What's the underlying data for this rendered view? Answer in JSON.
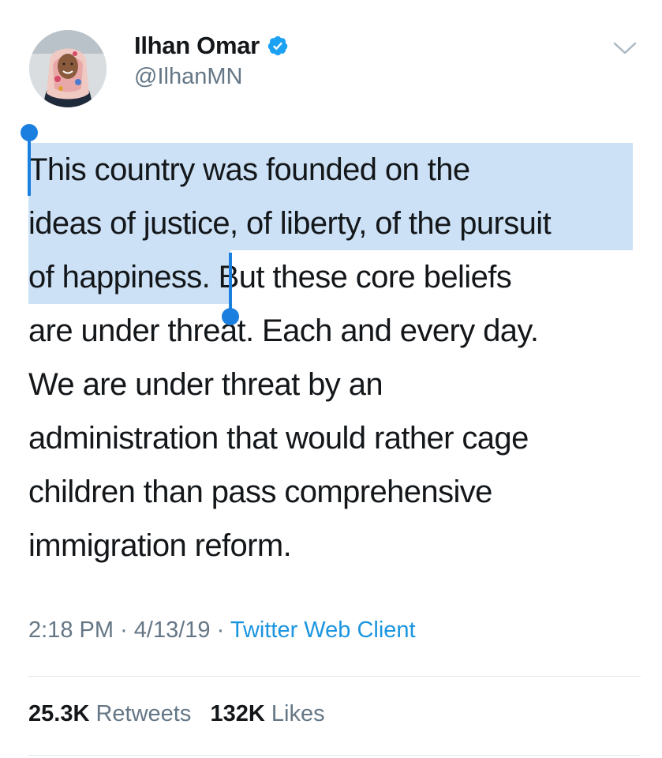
{
  "author": {
    "display_name": "Ilhan Omar",
    "handle": "@IlhanMN",
    "verified": true,
    "avatar_icon": "profile-photo"
  },
  "tweet": {
    "lines": [
      "This country was founded on the",
      "ideas of justice, of liberty, of the pursuit",
      "of happiness",
      ". But these core beliefs",
      "are under threat. Each and every day.",
      "We are under threat by an",
      "administration that would rather cage",
      "children than pass comprehensive",
      "immigration reform."
    ],
    "selection_color": "#cce1f6",
    "selection_handle_color": "#1b7fe0"
  },
  "meta": {
    "time": "2:18 PM",
    "separator": "·",
    "date": "4/13/19",
    "source": "Twitter Web Client"
  },
  "stats": {
    "retweets_count": "25.3K",
    "retweets_label": "Retweets",
    "likes_count": "132K",
    "likes_label": "Likes"
  },
  "colors": {
    "text": "#14171a",
    "secondary": "#657786",
    "link": "#1b95e0",
    "verified": "#1da1f2",
    "divider": "#e1e8ed"
  }
}
